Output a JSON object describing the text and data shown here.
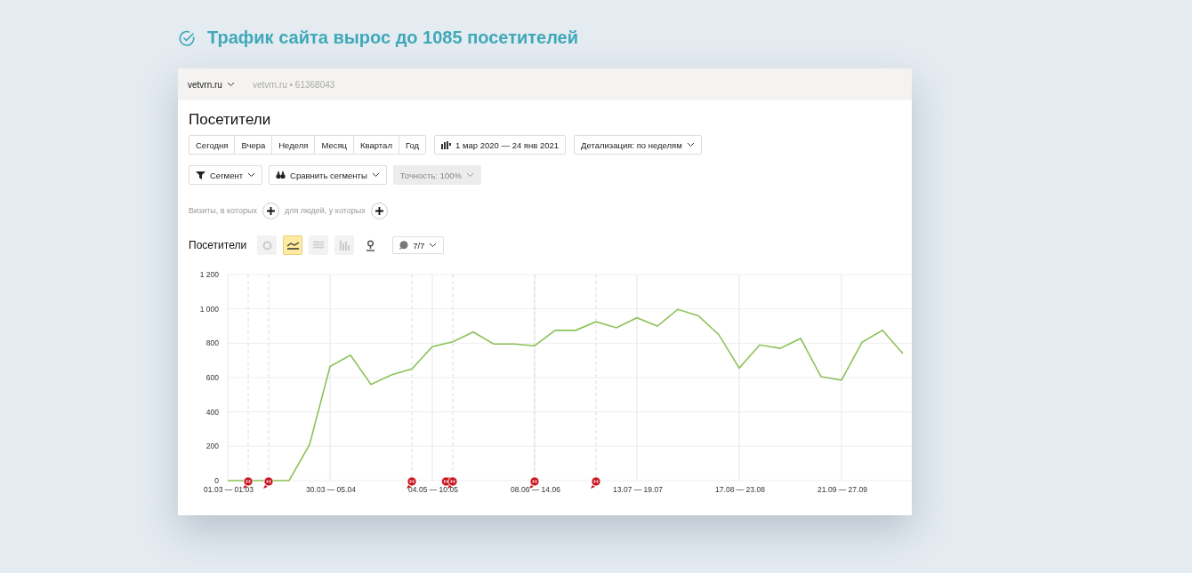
{
  "headline": "Трафик сайта вырос до 1085 посетителей",
  "top_bar": {
    "site": "vetvrn.ru",
    "counter": "vetvrn.ru • 61368043"
  },
  "page_title": "Посетители",
  "periods": [
    {
      "label": "Сегодня",
      "selected": false
    },
    {
      "label": "Вчера",
      "selected": false
    },
    {
      "label": "Неделя",
      "selected": false
    },
    {
      "label": "Месяц",
      "selected": false
    },
    {
      "label": "Квартал",
      "selected": false
    },
    {
      "label": "Год",
      "selected": false
    }
  ],
  "date_range": "1 мар 2020 — 24 янв 2021",
  "detail": "Детализация: по неделям",
  "segment": "Сегмент",
  "compare": "Сравнить сегменты",
  "accuracy": {
    "label": "Точность: 100%",
    "disabled": true
  },
  "filters": {
    "visits": "Визиты, в которых",
    "people": "для людей, у которых"
  },
  "chart_section": {
    "title": "Посетители",
    "chart_types": [
      {
        "kind": "pie",
        "selected": false
      },
      {
        "kind": "line",
        "selected": true
      },
      {
        "kind": "area",
        "selected": false
      },
      {
        "kind": "bar",
        "selected": false
      },
      {
        "kind": "map",
        "selected": false
      }
    ],
    "notes": "7/7",
    "chart_data": {
      "type": "line",
      "grid": true,
      "categories": [
        "01.03 — 01.03",
        null,
        null,
        null,
        null,
        "30.03 — 05.04",
        null,
        null,
        null,
        null,
        "04.05 — 10.05",
        null,
        null,
        null,
        null,
        "08.06 — 14.06",
        null,
        null,
        null,
        null,
        "13.07 — 19.07",
        null,
        null,
        null,
        null,
        "17.08 — 23.08",
        null,
        null,
        null,
        null,
        "21.09 — 27.09",
        null,
        null,
        null
      ],
      "series": [
        {
          "color": "#8cc25a",
          "values": [
            0,
            0,
            0,
            0,
            210,
            665,
            730,
            560,
            615,
            650,
            780,
            808,
            865,
            795,
            795,
            785,
            875,
            875,
            925,
            890,
            948,
            900,
            997,
            960,
            850,
            655,
            790,
            770,
            828,
            605,
            585,
            805,
            875,
            740
          ]
        }
      ],
      "ylim": [
        0,
        1200
      ],
      "yticks": [
        0,
        200,
        400,
        600,
        800,
        {
          "value": 1000,
          "label": "1 000"
        },
        {
          "value": 1200,
          "label": "1 200"
        }
      ]
    }
  }
}
